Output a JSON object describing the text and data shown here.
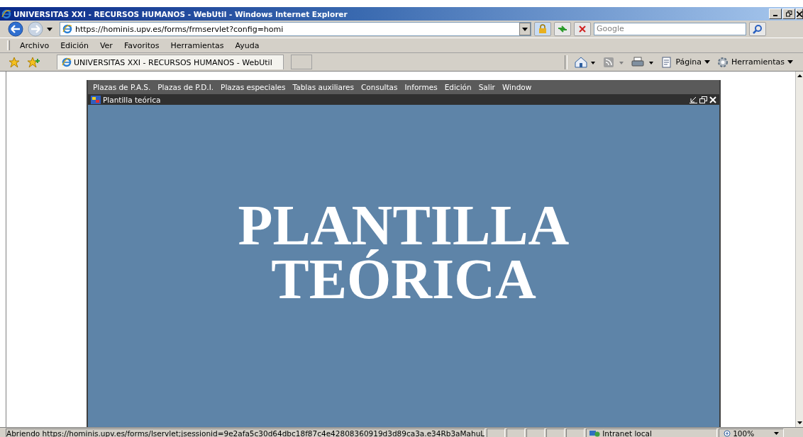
{
  "window": {
    "title": "UNIVERSITAS XXI - RECURSOS HUMANOS - WebUtil - Windows Internet Explorer"
  },
  "address_bar": {
    "url": "https://hominis.upv.es/forms/frmservlet?config=homi"
  },
  "search": {
    "placeholder": "Google"
  },
  "menu": [
    "Archivo",
    "Edición",
    "Ver",
    "Favoritos",
    "Herramientas",
    "Ayuda"
  ],
  "tabs": [
    {
      "label": "UNIVERSITAS XXI - RECURSOS HUMANOS - WebUtil",
      "selected": true
    }
  ],
  "command_bar": {
    "page": "Página",
    "tools": "Herramientas"
  },
  "app": {
    "menu": [
      "Plazas de P.A.S.",
      "Plazas de P.D.I.",
      "Plazas especiales",
      "Tablas auxiliares",
      "Consultas",
      "Informes",
      "Edición",
      "Salir",
      "Window"
    ],
    "internal_window": {
      "title": "Plantilla teórica",
      "heading": [
        "PLANTILLA",
        "TEÓRICA"
      ]
    }
  },
  "status_bar": {
    "text": "Abriendo https://hominis.upv.es/forms/lservlet;jsessionid=9e2afa5c30d64dbc18f87c4e42808360919d3d89ca3a.e34Rb3aMahuL",
    "zone": "Intranet local",
    "zoom": "100%"
  }
}
